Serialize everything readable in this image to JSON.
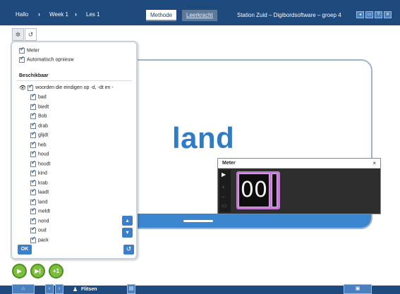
{
  "breadcrumb": [
    "Hallo",
    "Week 1",
    "Les 1"
  ],
  "tabs": [
    {
      "label": "Methode",
      "active": true
    },
    {
      "label": "Leerkracht",
      "active": false
    }
  ],
  "site_title": "Station Zuid – Digibordsoftware – groep 4",
  "window_buttons": [
    "back-icon",
    "window-icon",
    "help-icon",
    "close-icon"
  ],
  "panel": {
    "options": [
      {
        "label": "Meter",
        "checked": true
      },
      {
        "label": "Automatisch opnieuw",
        "checked": true
      }
    ],
    "section_title": "Beschikbaar",
    "group_label": "woorden die eindigen op -d, -dt en -",
    "words": [
      "bad",
      "biedt",
      "Bob",
      "drab",
      "glijdt",
      "heb",
      "houd",
      "houdt",
      "kind",
      "krab",
      "laadt",
      "land",
      "meldt",
      "nond",
      "oud",
      "pack"
    ],
    "ok_label": "OK"
  },
  "card": {
    "word": "land"
  },
  "meter": {
    "title": "Meter",
    "close": "×",
    "value": "00"
  },
  "controls": {
    "play": "▶",
    "next": "▶|",
    "plus_one": "+1"
  },
  "bottombar": {
    "mode_label": "Flitsen"
  },
  "colors": {
    "topbar": "#1e4a7e",
    "word": "#2e7bc6",
    "button": "#3a7fcb",
    "play": "#7bbf3d",
    "timer_frame": "#c27cd6"
  }
}
